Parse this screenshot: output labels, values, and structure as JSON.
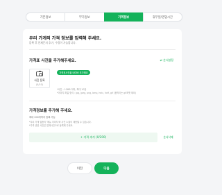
{
  "steps": [
    "기본정보",
    "부가정보",
    "가격정보",
    "휴무일/영업시간"
  ],
  "active_step": 2,
  "main": {
    "title": "우리 가게의 가격 정보를 입력해 주세요.",
    "subtitle": "등록 후 언제든지 추가, 수정이 가능합니다."
  },
  "photo_section": {
    "title": "가격표 사진을 추가해주세요.",
    "order_link": "⇄ 순서설정",
    "photo_label": "사진 등록",
    "photo_count": "(0/10)",
    "naver_button": "가격표사진을 네이버 추가해요",
    "note1": "*사진 : 10MB 이하, 최대 10장",
    "note2": "*이미지 파일 형식 : jpg, jpeg, png, bmp, heic, heif, gif (움직이는 gif포맷 제외)"
  },
  "price_section": {
    "title": "가격정보를 추가해 주세요.",
    "subtitle": "최대 200개까지 등록 가능",
    "note1": "*우리 가게 업종의 '메뉴 이미지'와 사진 노출이 제한될 수 있습니다.",
    "note2": "*가격 관련 사진은 업체사진으로 등록해 주세요.",
    "add_button": "+ 가격 추가 (0/200)",
    "sort_link": "순서삭제"
  },
  "footer": {
    "prev_label": "이전",
    "next_label": "다음"
  },
  "colors": {
    "accent": "#14b25a"
  }
}
